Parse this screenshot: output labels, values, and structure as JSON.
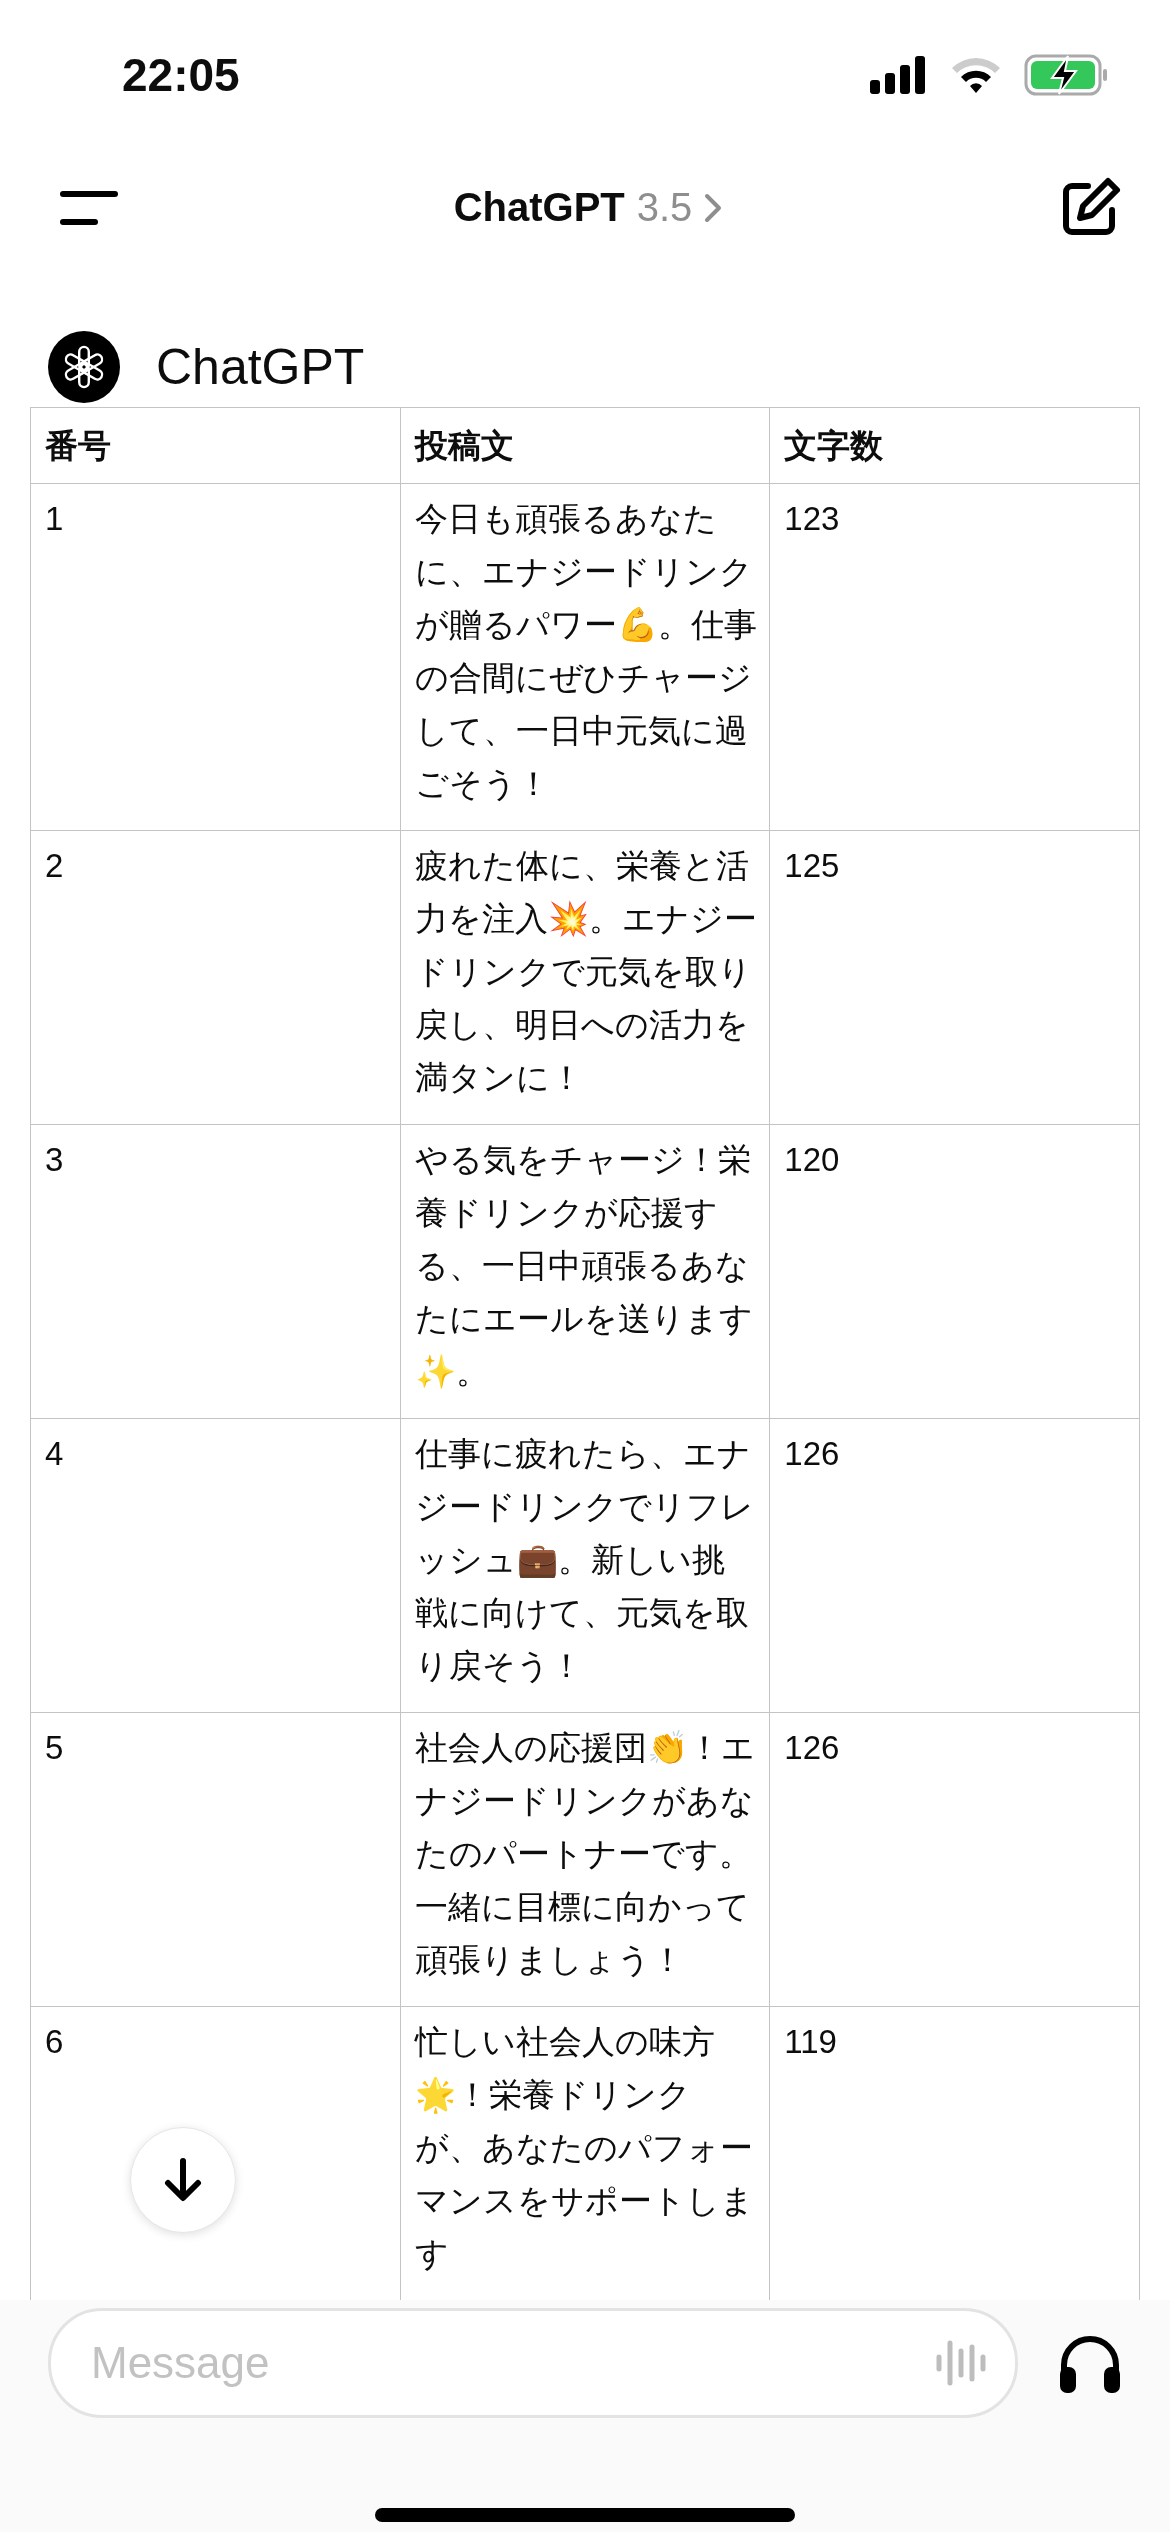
{
  "status_bar": {
    "time": "22:05"
  },
  "nav": {
    "title": "ChatGPT",
    "version": "3.5"
  },
  "message": {
    "sender": "ChatGPT",
    "table": {
      "columns": [
        "番号",
        "投稿文",
        "文字数"
      ],
      "rows": [
        [
          "1",
          "今日も頑張るあなたに、エナジードリンクが贈るパワー💪。仕事の合間にぜひチャージして、一日中元気に過ごそう！",
          "123"
        ],
        [
          "2",
          "疲れた体に、栄養と活力を注入💥。エナジードリンクで元気を取り戻し、明日への活力を満タンに！",
          "125"
        ],
        [
          "3",
          "やる気をチャージ！栄養ドリンクが応援する、一日中頑張るあなたにエールを送ります✨。",
          "120"
        ],
        [
          "4",
          "仕事に疲れたら、エナジードリンクでリフレッシュ💼。新しい挑戦に向けて、元気を取り戻そう！",
          "126"
        ],
        [
          "5",
          "社会人の応援団👏！エナジードリンクがあなたのパートナーです。一緒に目標に向かって頑張りましょう！",
          "126"
        ],
        [
          "6",
          "忙しい社会人の味方🌟！栄養ドリンクが、あなたのパフォーマンスをサポートします",
          "119"
        ]
      ]
    }
  },
  "composer": {
    "placeholder": "Message"
  }
}
